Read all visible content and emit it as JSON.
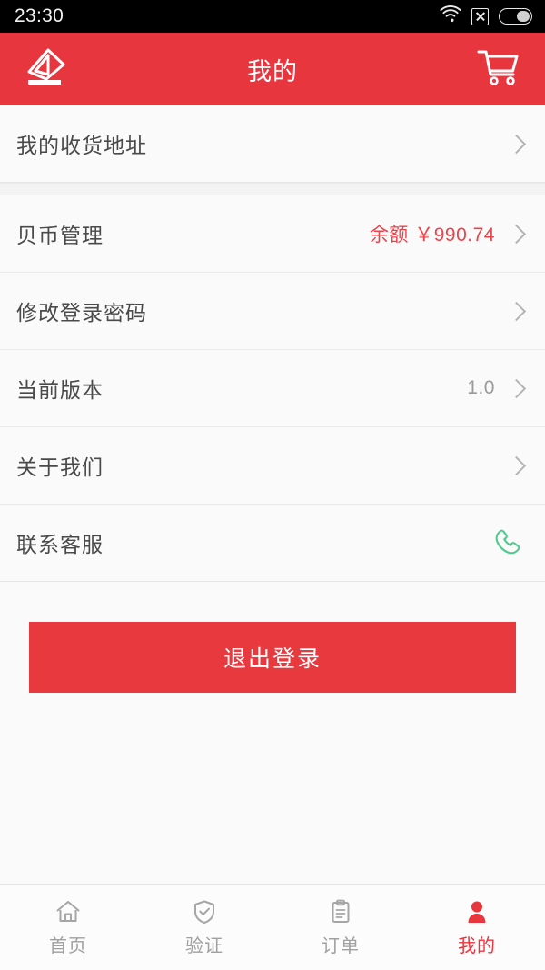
{
  "colors": {
    "brand_red": "#e8363f",
    "accent_red": "#e8444c",
    "phone_green": "#4ecb8d",
    "text_primary": "#4a4a4a",
    "text_muted": "#9a9a9a",
    "page_bg": "#fafafa"
  },
  "status_bar": {
    "time": "23:30",
    "wifi_icon": "wifi-icon",
    "signal_x_icon": "signal-no-service-icon",
    "battery_icon": "battery-icon"
  },
  "header": {
    "title": "我的",
    "logo_icon": "brand-logo-icon",
    "cart_icon": "shopping-cart-icon"
  },
  "list": {
    "groups": [
      {
        "rows": [
          {
            "label": "我的收货地址",
            "value": "",
            "accent": false,
            "trailing": "chevron",
            "name": "row-shipping-address"
          }
        ]
      },
      {
        "rows": [
          {
            "label": "贝币管理",
            "value": "余额 ￥990.74",
            "accent": true,
            "trailing": "chevron",
            "name": "row-coin-management"
          },
          {
            "label": "修改登录密码",
            "value": "",
            "accent": false,
            "trailing": "chevron",
            "name": "row-change-password"
          },
          {
            "label": "当前版本",
            "value": "1.0",
            "accent": false,
            "trailing": "chevron",
            "name": "row-current-version"
          },
          {
            "label": "关于我们",
            "value": "",
            "accent": false,
            "trailing": "chevron",
            "name": "row-about-us"
          },
          {
            "label": "联系客服",
            "value": "",
            "accent": false,
            "trailing": "phone",
            "name": "row-contact-service"
          }
        ]
      }
    ]
  },
  "logout": {
    "label": "退出登录"
  },
  "tab_bar": {
    "active_index": 3,
    "items": [
      {
        "label": "首页",
        "icon": "home-icon",
        "name": "tab-home"
      },
      {
        "label": "验证",
        "icon": "shield-check-icon",
        "name": "tab-verify"
      },
      {
        "label": "订单",
        "icon": "clipboard-icon",
        "name": "tab-orders"
      },
      {
        "label": "我的",
        "icon": "person-icon",
        "name": "tab-mine"
      }
    ]
  }
}
